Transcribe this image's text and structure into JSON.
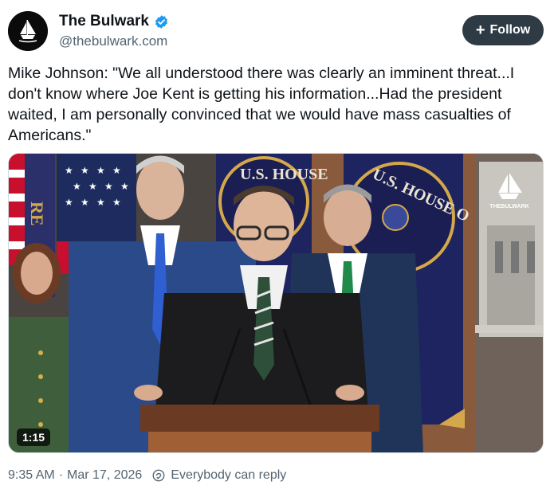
{
  "account": {
    "name": "The Bulwark",
    "handle": "@thebulwark.com",
    "verified": true,
    "avatar_icon": "bulwark-ship-logo"
  },
  "follow_button": {
    "label": "Follow",
    "icon": "plus-icon"
  },
  "tweet": {
    "text": "Mike Johnson: \"We all understood there was clearly an imminent threat...I don't know where Joe Kent is getting his information...Had the president waited, I am personally convinced that we would have mass casualties of Americans.\""
  },
  "media": {
    "duration": "1:15",
    "watermark": "THEBULWARK",
    "flag_text_left": "U.S. HOUSE",
    "flag_text_right": "U.S. HOUSE O"
  },
  "footer": {
    "time": "9:35 AM",
    "separator": "·",
    "date": "Mar 17, 2026",
    "reply_setting": "Everybody can reply"
  },
  "colors": {
    "follow_bg": "#2f3b44",
    "verified": "#1d9bf0",
    "muted": "#536471"
  }
}
